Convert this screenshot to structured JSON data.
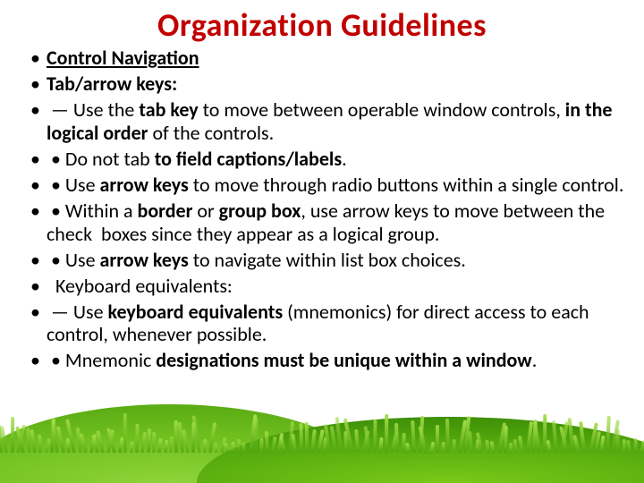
{
  "title": "Organization Guidelines",
  "items": [
    {
      "html": "<span class='b u'>Control Navigation</span>"
    },
    {
      "html": "<span class='b'>Tab/arrow keys:</span>"
    },
    {
      "html": "&nbsp;— Use the <span class='b'>tab key</span> to move between operable window controls, <span class='b'>in the logical order</span> of the controls."
    },
    {
      "html": "&nbsp;• Do not tab <span class='b'>to field captions/labels</span>."
    },
    {
      "html": "&nbsp;• Use <span class='b'>arrow keys</span> to move through radio buttons within a single control."
    },
    {
      "html": "&nbsp;• Within a <span class='b'>border</span> or <span class='b'>group box</span>, use arrow keys to move between the check &nbsp;boxes since they appear as a logical group."
    },
    {
      "html": "&nbsp;• Use <span class='b'>arrow keys</span> to navigate within list box choices."
    },
    {
      "html": "&nbsp; Keyboard equivalents:"
    },
    {
      "html": "&nbsp;— Use <span class='b'>keyboard equivalents</span> (mnemonics) for direct access to each control, whenever possible."
    },
    {
      "html": "&nbsp;• Mnemonic <span class='b'>designations must be unique within a window</span>."
    }
  ]
}
